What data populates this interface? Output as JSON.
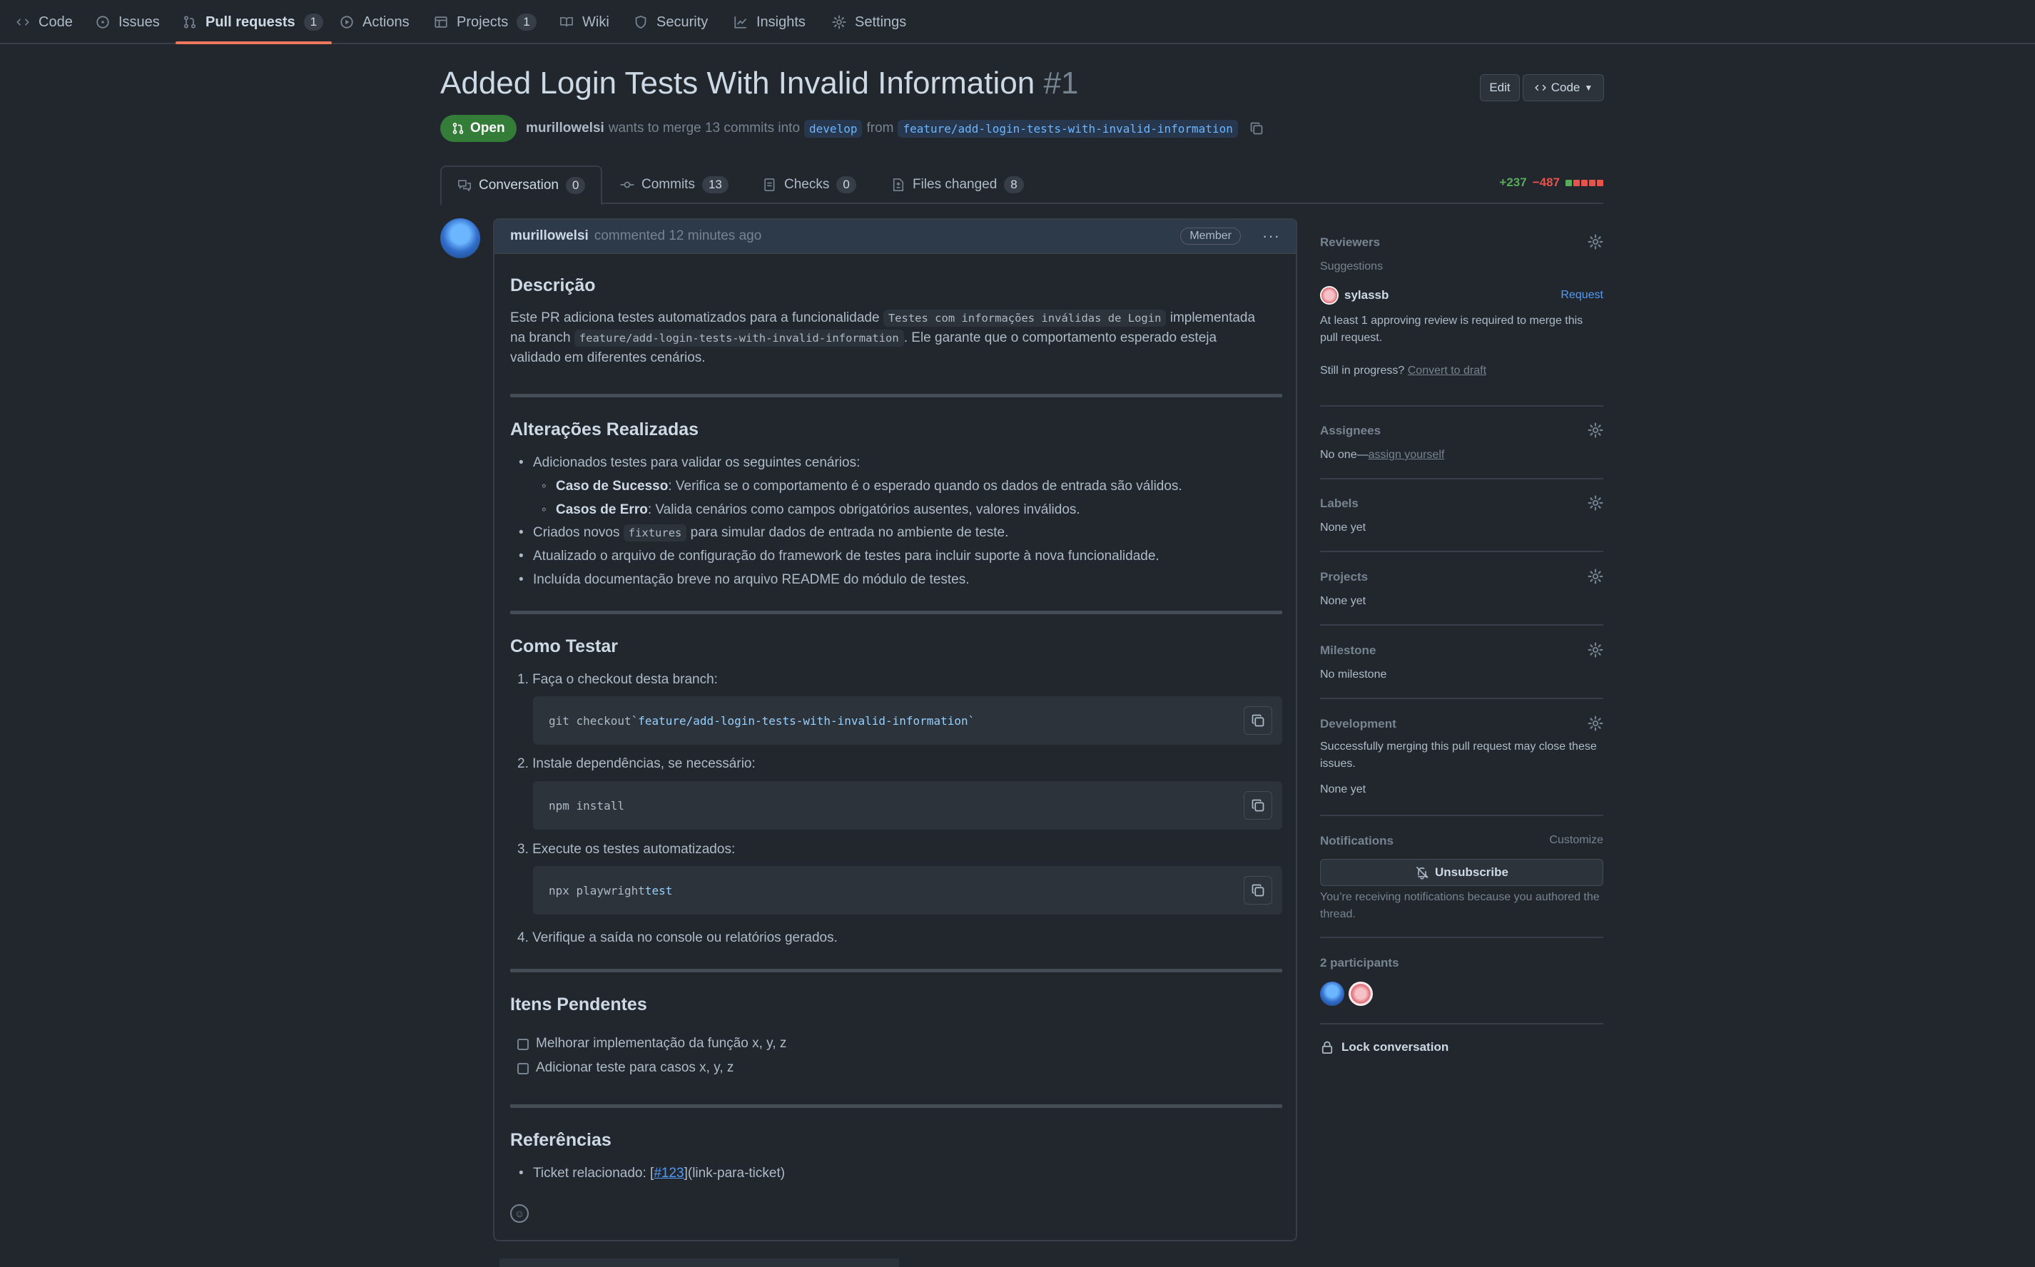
{
  "nav": {
    "code": "Code",
    "issues": "Issues",
    "pull_requests": "Pull requests",
    "pull_requests_count": "1",
    "actions": "Actions",
    "projects": "Projects",
    "projects_count": "1",
    "wiki": "Wiki",
    "security": "Security",
    "insights": "Insights",
    "settings": "Settings"
  },
  "pr": {
    "title": "Added Login Tests With Invalid Information",
    "number": "#1",
    "edit_label": "Edit",
    "code_label": "Code",
    "state": "Open",
    "author": "murillowelsi",
    "merge_text": "wants to merge 13 commits into",
    "base_branch": "develop",
    "from_text": "from",
    "head_branch": "feature/add-login-tests-with-invalid-information"
  },
  "tabs": [
    {
      "label": "Conversation",
      "count": "0"
    },
    {
      "label": "Commits",
      "count": "13"
    },
    {
      "label": "Checks",
      "count": "0"
    },
    {
      "label": "Files changed",
      "count": "8"
    }
  ],
  "diffstat": {
    "additions": "+237",
    "deletions": "−487"
  },
  "colors": {
    "accent": "#ec775c",
    "open": "#347d39",
    "add": "#57ab5a",
    "del": "#e5534b",
    "link": "#539bf5"
  },
  "comment": {
    "author": "murillowelsi",
    "meta": "commented 12 minutes ago",
    "role": "Member",
    "s1_title": "Descrição",
    "s1_p_a": "Este PR adiciona testes automatizados para a funcionalidade",
    "s1_code1": "Testes com informações inválidas de Login",
    "s1_p_b": "implementada",
    "s1_p_c": "na branch",
    "s1_code2": "feature/add-login-tests-with-invalid-information",
    "s1_p_d": ". Ele garante que o comportamento esperado esteja",
    "s1_p_e": "validado em diferentes cenários.",
    "s2_title": "Alterações Realizadas",
    "s2_li1": "Adicionados testes para validar os seguintes cenários:",
    "s2_sub1_b": "Caso de Sucesso",
    "s2_sub1_t": ": Verifica se o comportamento é o esperado quando os dados de entrada são válidos.",
    "s2_sub2_b": "Casos de Erro",
    "s2_sub2_t": ": Valida cenários como campos obrigatórios ausentes, valores inválidos.",
    "s2_li2_a": "Criados novos",
    "s2_li2_code": "fixtures",
    "s2_li2_b": "para simular dados de entrada no ambiente de teste.",
    "s2_li3": "Atualizado o arquivo de configuração do framework de testes para incluir suporte à nova funcionalidade.",
    "s2_li4": "Incluída documentação breve no arquivo README do módulo de testes.",
    "s3_title": "Como Testar",
    "s3_step1": "1.  Faça o checkout desta branch:",
    "s3_code1_a": "git checkout ",
    "s3_code1_b": "`feature/add-login-tests-with-invalid-information`",
    "s3_step2": "2.  Instale dependências, se necessário:",
    "s3_code2": "npm install",
    "s3_step3": "3.  Execute os testes automatizados:",
    "s3_code3_a": "npx playwright ",
    "s3_code3_b": "test",
    "s3_step4": "4.  Verifique a saída no console ou relatórios gerados.",
    "s4_title": "Itens Pendentes",
    "s4_task1": "Melhorar implementação da função x, y, z",
    "s4_task2": "Adicionar teste para casos x, y, z",
    "s5_title": "Referências",
    "s5_li_a": "Ticket relacionado: [",
    "s5_link": "#123",
    "s5_li_b": "](link-para-ticket)"
  },
  "sidebar": {
    "reviewers": "Reviewers",
    "suggestions": "Suggestions",
    "suggested_user": "sylassb",
    "request": "Request",
    "review_note": "At least 1 approving review is required to merge this pull request.",
    "in_progress": "Still in progress?",
    "convert_draft": "Convert to draft",
    "assignees": "Assignees",
    "no_one": "No one—",
    "assign_yourself": "assign yourself",
    "labels": "Labels",
    "labels_value": "None yet",
    "projects": "Projects",
    "projects_value": "None yet",
    "milestone": "Milestone",
    "milestone_value": "No milestone",
    "development": "Development",
    "development_note": "Successfully merging this pull request may close these issues.",
    "development_value": "None yet",
    "notifications": "Notifications",
    "customize": "Customize",
    "unsubscribe": "Unsubscribe",
    "notif_note": "You’re receiving notifications because you authored the thread.",
    "participants": "2 participants",
    "lock": "Lock conversation"
  }
}
